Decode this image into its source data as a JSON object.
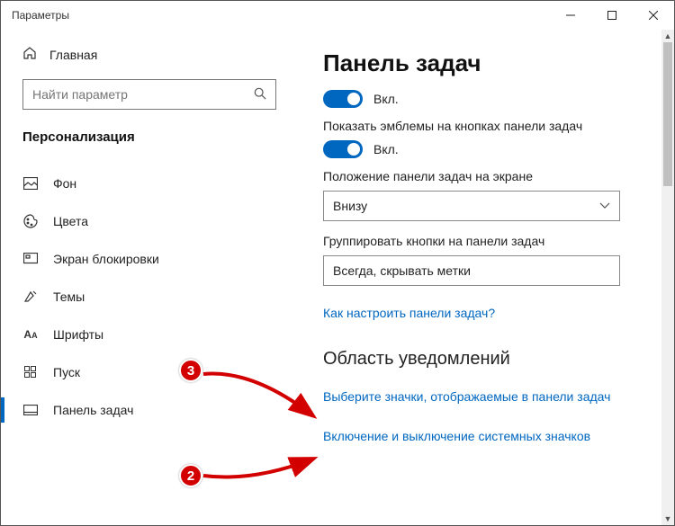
{
  "window": {
    "title": "Параметры"
  },
  "sidebar": {
    "home": "Главная",
    "search_placeholder": "Найти параметр",
    "category": "Персонализация",
    "items": [
      {
        "label": "Фон"
      },
      {
        "label": "Цвета"
      },
      {
        "label": "Экран блокировки"
      },
      {
        "label": "Темы"
      },
      {
        "label": "Шрифты"
      },
      {
        "label": "Пуск"
      },
      {
        "label": "Панель задач"
      }
    ]
  },
  "content": {
    "heading": "Панель задач",
    "toggle1_label": "Вкл.",
    "setting_emblems": "Показать эмблемы на кнопках панели задач",
    "toggle2_label": "Вкл.",
    "position_label": "Положение панели задач на экране",
    "position_value": "Внизу",
    "group_label": "Группировать кнопки на панели задач",
    "group_value": "Всегда, скрывать метки",
    "help_link": "Как настроить панели задач?",
    "section2": "Область уведомлений",
    "link_select_icons": "Выберите значки, отображаемые в панели задач",
    "link_toggle_system": "Включение и выключение системных значков"
  },
  "annotations": {
    "badge_top": "3",
    "badge_bottom": "2"
  }
}
